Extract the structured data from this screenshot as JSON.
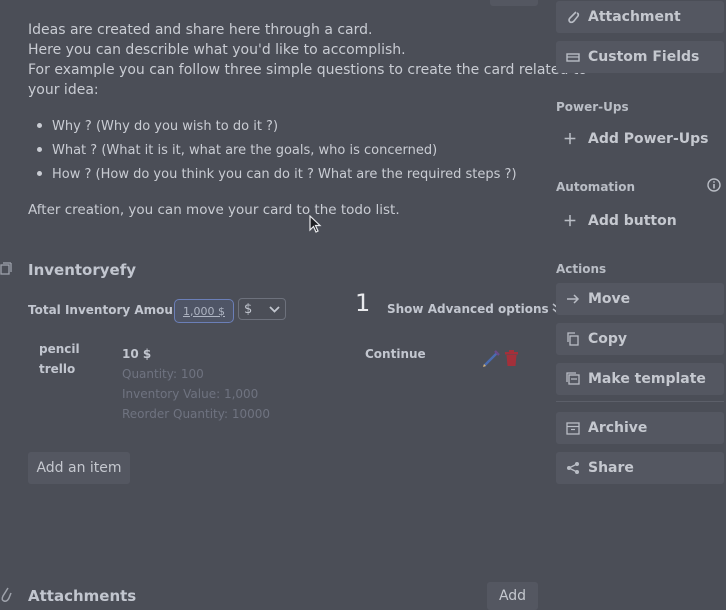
{
  "description": {
    "lines": [
      "Ideas are created and share here through a card.",
      "Here you can describle what you'd like to accomplish.",
      "For example you can follow three simple questions to create the card related to",
      "your idea:"
    ],
    "bullets": [
      "Why ? (Why do you wish to do it ?)",
      "What ? (What it is it, what are the goals, who is concerned)",
      "How ? (How do you think you can do it ? What are the required steps ?)"
    ],
    "footer": "After creation, you can move your card to the todo list."
  },
  "inventory": {
    "title": "Inventoryefy",
    "total_label": "Total Inventory Amount:",
    "total_value": "1,000 $",
    "currency": "$",
    "badge_number": "1",
    "advanced_label": "Show Advanced options",
    "item": {
      "name_line1": "pencil",
      "name_line2": "trello",
      "price": "10 $",
      "quantity": "Quantity: 100",
      "inventory_value": "Inventory Value: 1,000",
      "reorder": "Reorder Quantity: 10000",
      "continue_label": "Continue"
    },
    "add_item_label": "Add an item"
  },
  "attachments": {
    "title": "Attachments",
    "add_label": "Add"
  },
  "sidebar": {
    "top_buttons": [
      {
        "label": "Attachment",
        "icon": "paperclip-icon"
      },
      {
        "label": "Custom Fields",
        "icon": "custom-fields-icon"
      }
    ],
    "powerups_heading": "Power-Ups",
    "add_powerups": "Add Power-Ups",
    "automation_heading": "Automation",
    "add_button": "Add button",
    "actions_heading": "Actions",
    "actions": [
      {
        "label": "Move",
        "icon": "arrow-right-icon"
      },
      {
        "label": "Copy",
        "icon": "copy-icon"
      },
      {
        "label": "Make template",
        "icon": "template-icon"
      },
      {
        "label": "Archive",
        "icon": "archive-icon"
      },
      {
        "label": "Share",
        "icon": "share-icon"
      }
    ]
  },
  "colors": {
    "background": "#4b4e57",
    "button_bg": "#545761",
    "delete_red": "#a3303a",
    "edit_blue": "#4a6bb0",
    "select_border": "#6b7fb8"
  }
}
